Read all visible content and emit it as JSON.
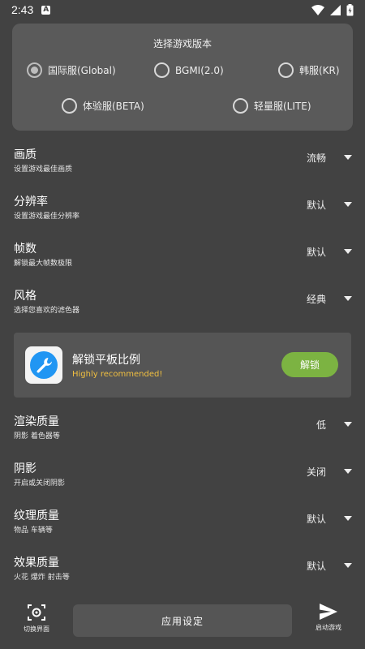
{
  "status_bar": {
    "time": "2:43",
    "notification_badge": "A",
    "icons": [
      "wifi-icon",
      "signal-icon",
      "battery-icon"
    ]
  },
  "version_selector": {
    "title": "选择游戏版本",
    "options": [
      {
        "label": "国际服(Global)",
        "selected": true
      },
      {
        "label": "BGMI(2.0)",
        "selected": false
      },
      {
        "label": "韩服(KR)",
        "selected": false
      },
      {
        "label": "体验服(BETA)",
        "selected": false
      },
      {
        "label": "轻量服(LITE)",
        "selected": false
      }
    ]
  },
  "settings": [
    {
      "title": "画质",
      "subtitle": "设置游戏最佳画质",
      "value": "流畅"
    },
    {
      "title": "分辨率",
      "subtitle": "设置游戏最佳分辨率",
      "value": "默认"
    },
    {
      "title": "帧数",
      "subtitle": "解锁最大帧数极限",
      "value": "默认"
    },
    {
      "title": "风格",
      "subtitle": "选择您喜欢的滤色器",
      "value": "经典"
    },
    {
      "title": "渲染质量",
      "subtitle": "阴影 着色器等",
      "value": "低"
    },
    {
      "title": "阴影",
      "subtitle": "开启或关闭阴影",
      "value": "关闭"
    },
    {
      "title": "纹理质量",
      "subtitle": "物品 车辆等",
      "value": "默认"
    },
    {
      "title": "效果质量",
      "subtitle": "火花 爆炸 射击等",
      "value": "默认"
    }
  ],
  "promo": {
    "title": "解锁平板比例",
    "subtitle": "Highly recommended!",
    "button_label": "解锁",
    "icon": "wrench-icon",
    "accent": "#7cb342",
    "subtitle_color": "#f2c040",
    "icon_color": "#2196f3"
  },
  "bottom_bar": {
    "switch_label": "切换界面",
    "apply_label": "应用设定",
    "launch_label": "启动游戏"
  },
  "colors": {
    "background": "#424242",
    "card": "#5a5a5a"
  }
}
